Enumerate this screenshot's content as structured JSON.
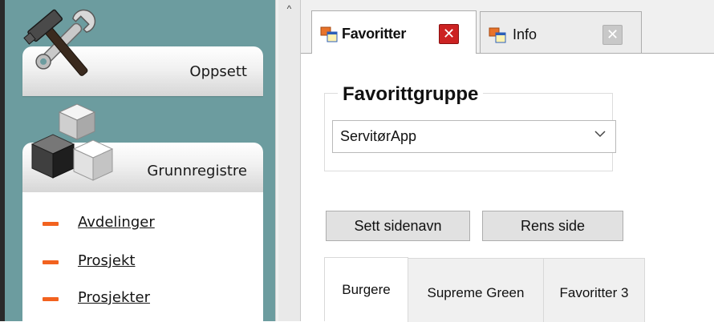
{
  "sidebar": {
    "sections": [
      {
        "label": "Oppsett",
        "icon": "tools-icon"
      },
      {
        "label": "Grunnregistre",
        "icon": "cubes-icon"
      }
    ],
    "items": [
      {
        "label": "Avdelinger"
      },
      {
        "label": "Prosjekt"
      },
      {
        "label": "Prosjekter"
      }
    ]
  },
  "scroll": {
    "up_glyph": "^"
  },
  "tabs": [
    {
      "label": "Favoritter",
      "close": "✕",
      "active": true
    },
    {
      "label": "Info",
      "close": "✕",
      "active": false
    }
  ],
  "favorites": {
    "group_title": "Favorittgruppe",
    "selected_group": "ServitørApp",
    "set_page_name_label": "Sett sidenavn",
    "clear_page_label": "Rens side",
    "pages": [
      {
        "label": "Burgere",
        "active": true
      },
      {
        "label": "Supreme Green",
        "active": false
      },
      {
        "label": "Favoritter 3",
        "active": false
      }
    ]
  },
  "colors": {
    "sidebar_bg": "#6c9c9f",
    "bullet": "#f2621f",
    "close_active": "#cc2222",
    "close_inactive": "#c8c8c8"
  }
}
